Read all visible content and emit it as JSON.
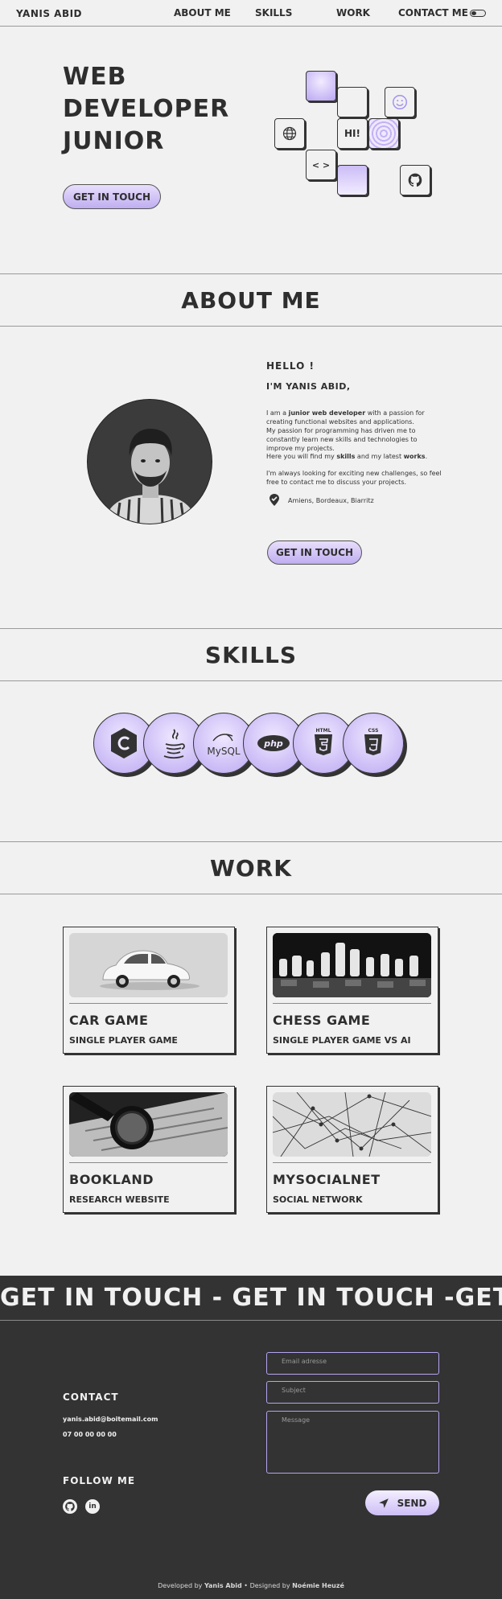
{
  "nav": {
    "brand": "YANIS ABID",
    "links": [
      "ABOUT ME",
      "SKILLS",
      "WORK",
      "CONTACT ME"
    ]
  },
  "hero": {
    "title_lines": [
      "WEB",
      "DEVELOPER",
      "JUNIOR"
    ],
    "cta": "GET IN TOUCH",
    "tile_hi": "HI!",
    "tile_code": "< >"
  },
  "sections": {
    "about": "ABOUT ME",
    "skills": "SKILLS",
    "work": "WORK"
  },
  "about": {
    "hello": "HELLO !",
    "name": "I'M YANIS ABID,",
    "p1_pre": "I am a ",
    "p1_bold": "junior web developer",
    "p1_post": " with a passion for creating functional websites and applications.",
    "p2": "My passion for programming has driven me to constantly learn new skills and technologies to improve my projects.",
    "p3_pre": "Here you will find my ",
    "p3_b1": "skills",
    "p3_mid": " and my latest ",
    "p3_b2": "works",
    "p3_end": ".",
    "p4": "I'm always looking for exciting new challenges, so feel free to contact me to discuss your projects.",
    "location": "Amiens, Bordeaux, Biarritz",
    "cta": "GET IN TOUCH"
  },
  "skills": [
    {
      "icon": "c-icon",
      "label": "C"
    },
    {
      "icon": "java-icon",
      "label": ""
    },
    {
      "icon": "mysql-icon",
      "label": "MySQL"
    },
    {
      "icon": "php-icon",
      "label": "php"
    },
    {
      "icon": "html5-icon",
      "label": "HTML"
    },
    {
      "icon": "css3-icon",
      "label": "CSS"
    }
  ],
  "work": [
    {
      "title": "CAR GAME",
      "subtitle": "SINGLE PLAYER GAME"
    },
    {
      "title": "CHESS GAME",
      "subtitle": "SINGLE PLAYER GAME VS AI"
    },
    {
      "title": "BOOKLAND",
      "subtitle": "RESEARCH WEBSITE"
    },
    {
      "title": "MYSOCIALNET",
      "subtitle": "SOCIAL NETWORK"
    }
  ],
  "marquee": "GET IN TOUCH - GET IN TOUCH -GET",
  "contact": {
    "title": "CONTACT",
    "email": "yanis.abid@boitemail.com",
    "phone": "07 00 00 00 00",
    "follow": "FOLLOW ME",
    "email_placeholder": "Email adresse",
    "subject_placeholder": "Subject",
    "message_placeholder": "Message",
    "send": "SEND"
  },
  "footer": {
    "dev_pre": "Developed by ",
    "dev_name": "Yanis Abid",
    "sep": " • Designed by ",
    "design_name": "Noémie Heuzé"
  },
  "colors": {
    "accent": "#bfaef0",
    "dark": "#333333",
    "background": "#f1f1f1"
  }
}
